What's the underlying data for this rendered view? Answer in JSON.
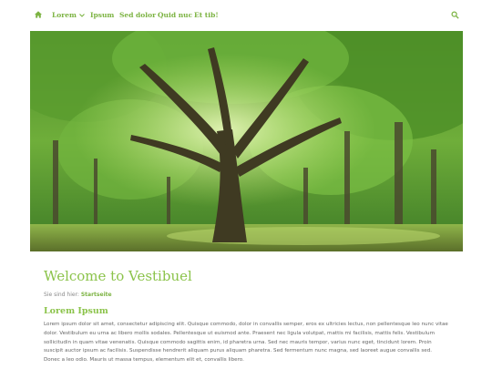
{
  "nav": {
    "home_icon": "home-icon",
    "items": [
      {
        "label": "Lorem",
        "has_dropdown": true
      },
      {
        "label": "Ipsum"
      },
      {
        "label": "Sed dolor"
      },
      {
        "label": "Quid nuc"
      },
      {
        "label": "Et tib!"
      }
    ],
    "search_icon": "search-icon"
  },
  "hero": {
    "image": "forest-tree-photo"
  },
  "main": {
    "title": "Welcome to Vestibuel",
    "breadcrumb": {
      "prefix": "Sie sind hier:",
      "current": "Startseite"
    },
    "section_title": "Lorem Ipsum",
    "paragraph": "Lorem ipsum dolor sit amet, consectetur adipiscing elit. Quisque commodo, dolor in convallis semper, eros ex ultricies lectus, non pellentesque leo nunc vitae dolor. Vestibulum eu urna ac libero mollis sodales. Pellentesque ut euismod ante. Praesent nec ligula volutpat, mattis mi facilisis, mattis felis. Vestibulum sollicitudin in quam vitae venenatis. Quisque commodo sagittis enim, id pharetra urna. Sed nec mauris tempor, varius nunc eget, tincidunt lorem. Proin suscipit auctor ipsum ac facilisis. Suspendisse hendrerit aliquam purus aliquam pharetra. Sed fermentum nunc magna, sed laoreet augue convallis sed. Donec a leo odio. Mauris ut massa tempus, elementum elit et, convallis libero."
  },
  "colors": {
    "accent": "#8bc34a",
    "accent_dark": "#7cb342",
    "text": "#666666"
  }
}
